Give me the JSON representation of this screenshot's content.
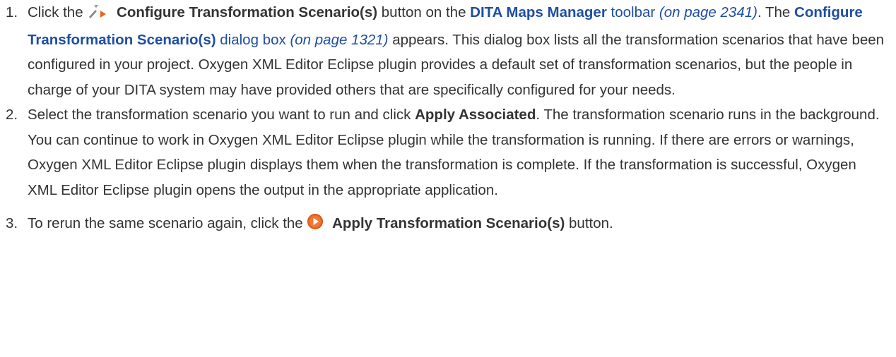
{
  "steps": [
    {
      "number": "1.",
      "pre_icon": "Click the",
      "icon": "configure-scenario-icon",
      "button": "Configure Transformation Scenario(s)",
      "t1": "button on the",
      "link1": "DITA Maps Manager",
      "link1_suffix": "toolbar",
      "ref1": "(on page 2341)",
      "t2": ". The",
      "link2": "Configure Transformation Scenario(s)",
      "link2_suffix": "dialog box",
      "ref2": "(on page 1321)",
      "t3": "appears. This dialog box lists all the transformation scenarios that have been configured in your project. Oxygen XML Editor Eclipse plugin provides a default set of transformation scenarios, but the people in charge of your DITA system may have provided others that are specifically configured for your needs."
    },
    {
      "number": "2.",
      "t1": "Select the transformation scenario you want to run and click",
      "button": "Apply Associated",
      "t2": ". The transformation scenario runs in the background. You can continue to work in Oxygen XML Editor Eclipse plugin while the transformation is running. If there are errors or warnings, Oxygen XML Editor Eclipse plugin displays them when the transformation is complete. If the transformation is successful, Oxygen XML Editor Eclipse plugin opens the output in the appropriate application."
    },
    {
      "number": "3.",
      "t1": "To rerun the same scenario again, click the",
      "icon": "apply-scenario-icon",
      "button": "Apply Transformation Scenario(s)",
      "t2": "button."
    }
  ],
  "colors": {
    "text": "#333333",
    "link": "#1f4ea3",
    "icon_orange": "#e8641e",
    "icon_gray": "#8a8a8a"
  }
}
